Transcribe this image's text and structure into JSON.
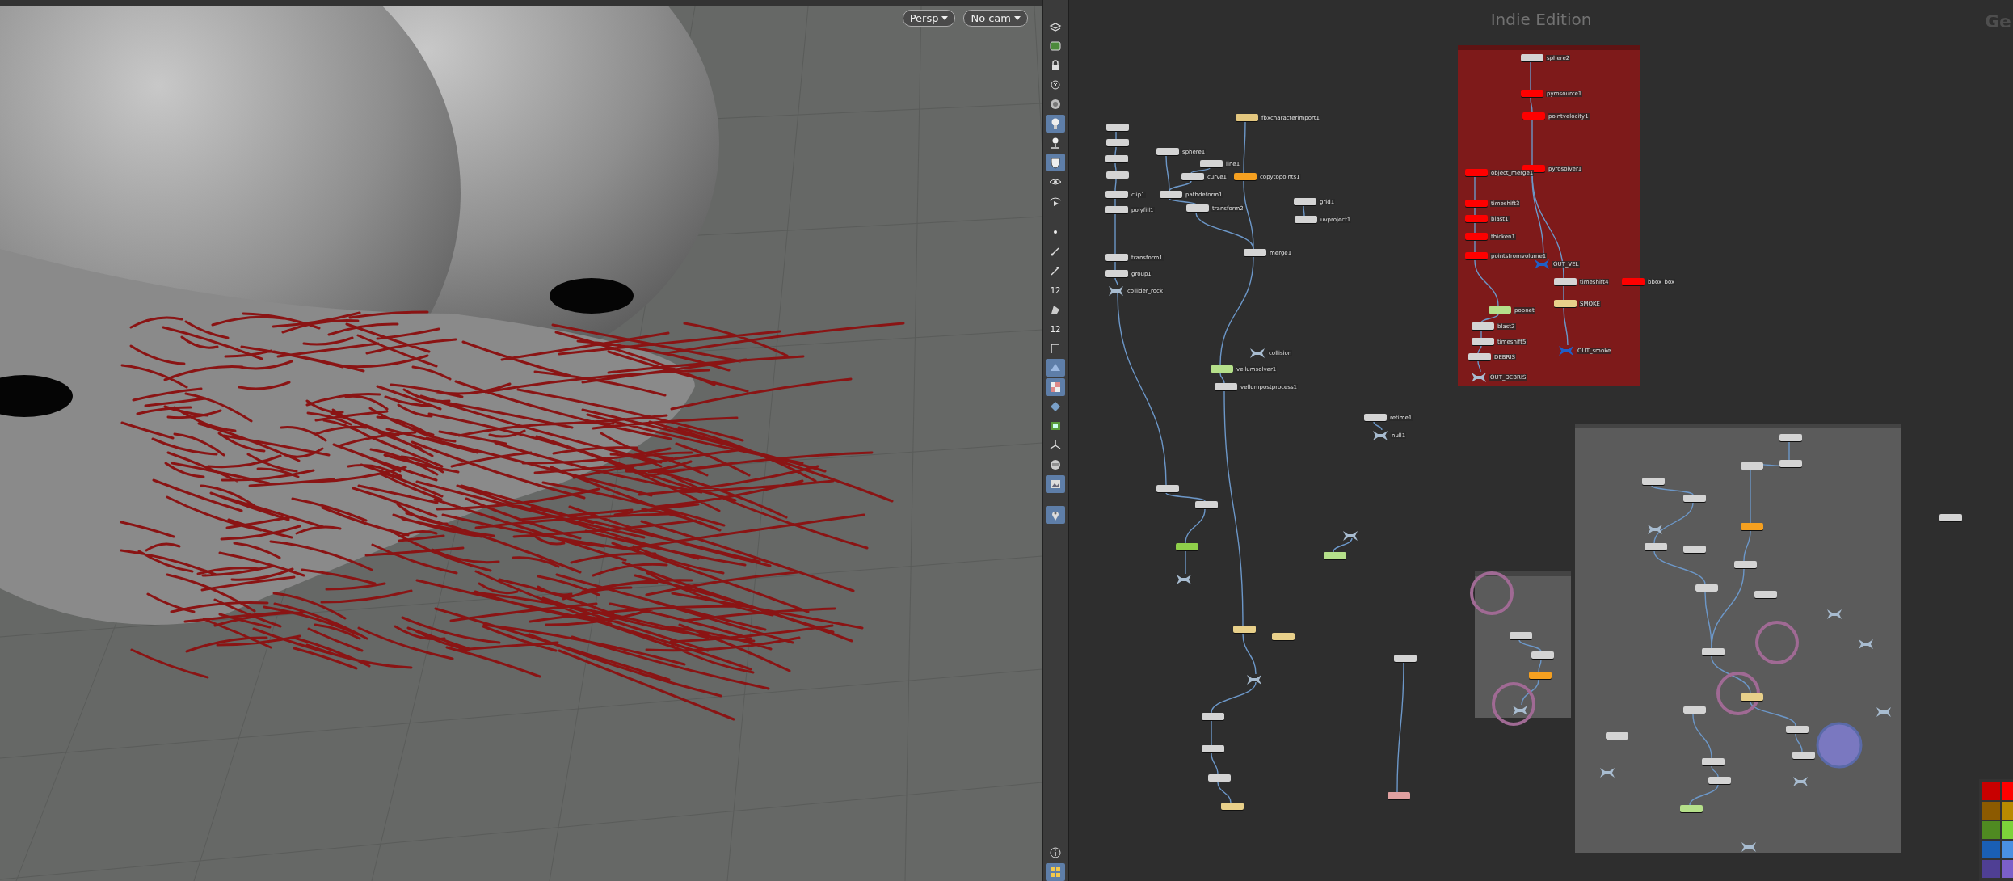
{
  "viewport": {
    "camera_buttons": [
      {
        "label": "Persp"
      },
      {
        "label": "No cam"
      }
    ]
  },
  "viewport_toolbar": {
    "tools": [
      {
        "selected": false
      },
      {
        "selected": false
      },
      {
        "selected": false
      },
      {
        "selected": false
      },
      {
        "selected": false
      },
      {
        "selected": true
      },
      {
        "selected": false
      },
      {
        "selected": true
      },
      {
        "selected": false
      },
      {
        "selected": false
      },
      {
        "selected": false
      },
      {
        "selected": false
      },
      {
        "selected": false
      },
      {
        "selected": false,
        "text": "12"
      },
      {
        "selected": false
      },
      {
        "selected": false,
        "text": "12"
      },
      {
        "selected": false
      },
      {
        "selected": true
      },
      {
        "selected": true
      },
      {
        "selected": false
      },
      {
        "selected": false
      },
      {
        "selected": false
      },
      {
        "selected": false
      },
      {
        "selected": true
      },
      {
        "selected": true
      }
    ],
    "bottom_tools": [
      {
        "selected": false
      },
      {
        "selected": true
      }
    ]
  },
  "network_editor": {
    "edition_label": "Indie Edition",
    "heading_fragment": "Ge",
    "network_boxes": [
      {
        "color": "#7e1a1a"
      },
      {
        "color": "#5b5b5b"
      },
      {
        "color": "#5b5b5b"
      }
    ],
    "nodes": [
      {
        "kind": "node",
        "label": "fbxcharacterimport1",
        "color": "#e3c77f"
      },
      {
        "kind": "node",
        "label": "sphere1",
        "color": "#d4d4d4"
      },
      {
        "kind": "node",
        "label": "line1",
        "color": "#d4d4d4"
      },
      {
        "kind": "node",
        "label": "curve1",
        "color": "#d4d4d4"
      },
      {
        "kind": "node",
        "label": "copytopoints1",
        "color": "#f5a020"
      },
      {
        "kind": "node",
        "label": "pathdeform1",
        "color": "#d4d4d4"
      },
      {
        "kind": "node",
        "label": "transform2",
        "color": "#d4d4d4"
      },
      {
        "kind": "node",
        "label": "clip1",
        "color": "#d4d4d4"
      },
      {
        "kind": "node",
        "label": "polyfill1",
        "color": "#d4d4d4"
      },
      {
        "kind": "node",
        "label": "transform1",
        "color": "#d4d4d4"
      },
      {
        "kind": "node",
        "label": "group1",
        "color": "#d4d4d4"
      },
      {
        "kind": "null",
        "label": "collider_rock",
        "color": "#a8bcd0"
      },
      {
        "kind": "node",
        "label": "merge1",
        "color": "#d4d4d4"
      },
      {
        "kind": "node",
        "label": "grid1",
        "color": "#d4d4d4"
      },
      {
        "kind": "node",
        "label": "uvproject1",
        "color": "#d4d4d4"
      },
      {
        "kind": "null",
        "label": "collision",
        "color": "#a8bcd0"
      },
      {
        "kind": "node",
        "label": "vellumsolver1",
        "color": "#b5e08a"
      },
      {
        "kind": "node",
        "label": "vellumpostprocess1",
        "color": "#d4d4d4"
      },
      {
        "kind": "node",
        "label": "retime1",
        "color": "#d4d4d4"
      },
      {
        "kind": "null",
        "label": "null1",
        "color": "#a8bcd0"
      },
      {
        "kind": "node",
        "label": "sphere2",
        "color": "#d4d4d4"
      },
      {
        "kind": "node",
        "label": "pyrosource1",
        "color": "#ff0000"
      },
      {
        "kind": "node",
        "label": "pointvelocity1",
        "color": "#ff0000"
      },
      {
        "kind": "node",
        "label": "pyrosolver1",
        "color": "#ff0000"
      },
      {
        "kind": "node",
        "label": "object_merge1",
        "color": "#ff0000"
      },
      {
        "kind": "node",
        "label": "timeshift3",
        "color": "#ff0000"
      },
      {
        "kind": "node",
        "label": "blast1",
        "color": "#ff0000"
      },
      {
        "kind": "node",
        "label": "thicken1",
        "color": "#ff0000"
      },
      {
        "kind": "node",
        "label": "pointsfromvolume1",
        "color": "#ff0000"
      },
      {
        "kind": "null",
        "label": "OUT_VEL",
        "color": "#1f5fc8"
      },
      {
        "kind": "node",
        "label": "timeshift4",
        "color": "#d4d4d4"
      },
      {
        "kind": "node",
        "label": "bbox_box",
        "color": "#ff0000"
      },
      {
        "kind": "node",
        "label": "SMOKE",
        "color": "#e8d08a"
      },
      {
        "kind": "node",
        "label": "popnet",
        "color": "#b5e08a"
      },
      {
        "kind": "node",
        "label": "blast2",
        "color": "#d4d4d4"
      },
      {
        "kind": "node",
        "label": "timeshift5",
        "color": "#d4d4d4"
      },
      {
        "kind": "node",
        "label": "DEBRIS",
        "color": "#d4d4d4"
      },
      {
        "kind": "null",
        "label": "OUT_smoke",
        "color": "#1f5fc8"
      },
      {
        "kind": "null",
        "label": "OUT_DEBRIS",
        "color": "#a8bcd0"
      },
      {
        "kind": "node",
        "color": "#d4d4d4"
      },
      {
        "kind": "node",
        "color": "#d4d4d4"
      },
      {
        "kind": "node",
        "color": "#d4d4d4"
      },
      {
        "kind": "node",
        "color": "#d4d4d4"
      },
      {
        "kind": "node",
        "color": "#d4d4d4"
      },
      {
        "kind": "node",
        "color": "#d4d4d4"
      },
      {
        "kind": "node",
        "color": "#8fcf4a"
      },
      {
        "kind": "null",
        "color": "#a8bcd0"
      },
      {
        "kind": "node",
        "color": "#e8d08a"
      },
      {
        "kind": "node",
        "color": "#e8d08a"
      },
      {
        "kind": "null",
        "color": "#a8bcd0"
      },
      {
        "kind": "node",
        "color": "#d4d4d4"
      },
      {
        "kind": "node",
        "color": "#d4d4d4"
      },
      {
        "kind": "node",
        "color": "#d4d4d4"
      },
      {
        "kind": "node",
        "color": "#e8d08a"
      },
      {
        "kind": "node",
        "color": "#e0a0a0"
      },
      {
        "kind": "node",
        "color": "#d4d4d4"
      },
      {
        "kind": "node",
        "color": "#b5e08a"
      },
      {
        "kind": "null",
        "color": "#a8bcd0"
      },
      {
        "kind": "node",
        "color": "#d4d4d4"
      },
      {
        "kind": "node",
        "color": "#d4d4d4"
      },
      {
        "kind": "node",
        "color": "#d4d4d4"
      },
      {
        "kind": "node",
        "color": "#d4d4d4"
      },
      {
        "kind": "node",
        "color": "#d4d4d4"
      },
      {
        "kind": "node",
        "color": "#f5a020"
      },
      {
        "kind": "node",
        "color": "#d4d4d4"
      },
      {
        "kind": "node",
        "color": "#d4d4d4"
      },
      {
        "kind": "node",
        "color": "#d4d4d4"
      },
      {
        "kind": "node",
        "color": "#d4d4d4"
      },
      {
        "kind": "node",
        "color": "#d4d4d4"
      },
      {
        "kind": "node",
        "color": "#d4d4d4"
      },
      {
        "kind": "node",
        "color": "#e8d08a"
      },
      {
        "kind": "node",
        "color": "#d4d4d4"
      },
      {
        "kind": "node",
        "color": "#d4d4d4"
      },
      {
        "kind": "node",
        "color": "#d4d4d4"
      },
      {
        "kind": "node",
        "color": "#d4d4d4"
      },
      {
        "kind": "node",
        "color": "#d4d4d4"
      },
      {
        "kind": "node",
        "color": "#d4d4d4"
      },
      {
        "kind": "node",
        "color": "#b5e08a"
      },
      {
        "kind": "node",
        "color": "#d4d4d4"
      },
      {
        "kind": "node",
        "color": "#f5a020"
      },
      {
        "kind": "node",
        "color": "#d4d4d4"
      },
      {
        "kind": "null",
        "color": "#a8bcd0"
      },
      {
        "kind": "null",
        "color": "#a8bcd0"
      },
      {
        "kind": "null",
        "color": "#a8bcd0"
      },
      {
        "kind": "null",
        "color": "#a8bcd0"
      },
      {
        "kind": "null",
        "color": "#a8bcd0"
      },
      {
        "kind": "null",
        "color": "#a8bcd0"
      },
      {
        "kind": "null",
        "color": "#a8bcd0"
      },
      {
        "kind": "null",
        "color": "#a8bcd0"
      },
      {
        "kind": "node",
        "color": "#d4d4d4"
      }
    ],
    "color_palette": [
      {
        "color": "#c80000"
      },
      {
        "color": "#ff0000"
      },
      {
        "color": "#8c5a00"
      },
      {
        "color": "#b98a00"
      },
      {
        "color": "#4f8a21"
      },
      {
        "color": "#7dd33a"
      },
      {
        "color": "#1a5fb4"
      },
      {
        "color": "#4a90e2"
      },
      {
        "color": "#4f3f94"
      },
      {
        "color": "#7b5fc9"
      }
    ]
  }
}
